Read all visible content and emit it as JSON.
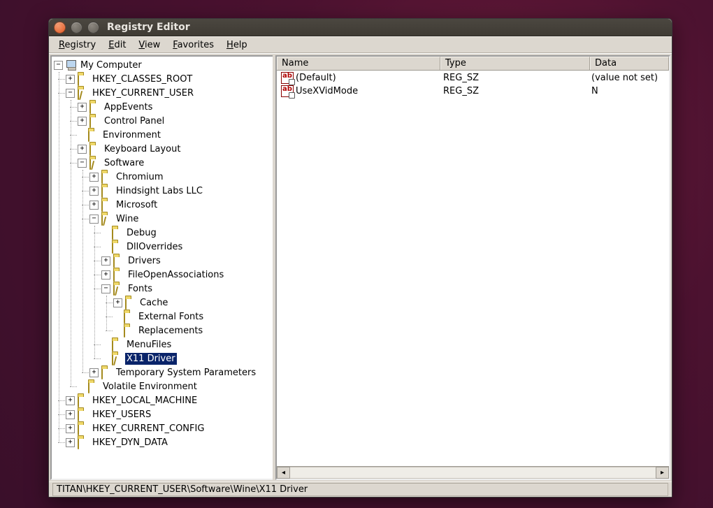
{
  "window": {
    "title": "Registry Editor"
  },
  "menu": {
    "registry": "Registry",
    "edit": "Edit",
    "view": "View",
    "favorites": "Favorites",
    "help": "Help"
  },
  "tree": {
    "root": "My Computer",
    "hkcr": "HKEY_CLASSES_ROOT",
    "hkcu": "HKEY_CURRENT_USER",
    "hkcu_children": {
      "appevents": "AppEvents",
      "controlpanel": "Control Panel",
      "environment": "Environment",
      "keyboardlayout": "Keyboard Layout",
      "software": "Software",
      "software_children": {
        "chromium": "Chromium",
        "hindsight": "Hindsight Labs LLC",
        "microsoft": "Microsoft",
        "wine": "Wine",
        "wine_children": {
          "debug": "Debug",
          "dlloverrides": "DllOverrides",
          "drivers": "Drivers",
          "fileopen": "FileOpenAssociations",
          "fonts": "Fonts",
          "fonts_children": {
            "cache": "Cache",
            "external": "External Fonts",
            "replacements": "Replacements"
          },
          "menufiles": "MenuFiles",
          "x11driver": "X11 Driver"
        },
        "tempsys": "Temporary System Parameters"
      },
      "volatile": "Volatile Environment"
    },
    "hklm": "HKEY_LOCAL_MACHINE",
    "hku": "HKEY_USERS",
    "hkcc": "HKEY_CURRENT_CONFIG",
    "hkdd": "HKEY_DYN_DATA"
  },
  "columns": {
    "name": "Name",
    "type": "Type",
    "data": "Data"
  },
  "values": [
    {
      "name": "(Default)",
      "type": "REG_SZ",
      "data": "(value not set)"
    },
    {
      "name": "UseXVidMode",
      "type": "REG_SZ",
      "data": "N"
    }
  ],
  "statusbar": "TITAN\\HKEY_CURRENT_USER\\Software\\Wine\\X11 Driver"
}
